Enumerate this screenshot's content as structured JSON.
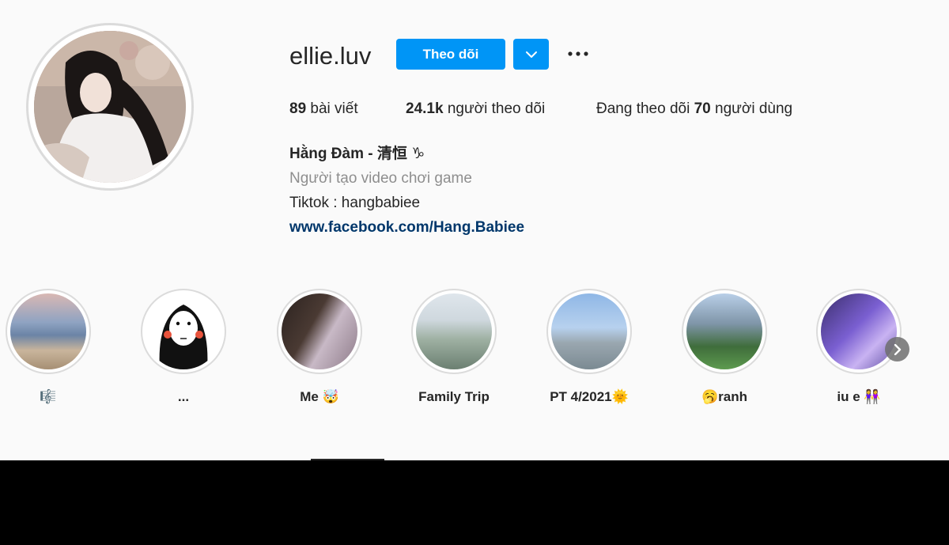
{
  "profile": {
    "username": "ellie.luv",
    "follow_label": "Theo dõi",
    "dropdown_icon": "chevron-down-icon",
    "more_icon": "more-options-icon"
  },
  "stats": {
    "posts_count": "89",
    "posts_label": " bài viết",
    "followers_count": "24.1k",
    "followers_label": " người theo dõi",
    "following_prefix": "Đang theo dõi ",
    "following_count": "70",
    "following_suffix": " người dùng"
  },
  "bio": {
    "name": "Hằng Đàm - 清恒 ♑",
    "category": "Người tạo video chơi game",
    "text": "Tiktok : hangbabiee",
    "link": "www.facebook.com/Hang.Babiee"
  },
  "highlights": [
    {
      "label": "🎼"
    },
    {
      "label": "..."
    },
    {
      "label": "Me 🤯"
    },
    {
      "label": "Family Trip"
    },
    {
      "label": "PT 4/2021🌞"
    },
    {
      "label": "🥱ranh"
    },
    {
      "label": "iu e 👭"
    }
  ],
  "colors": {
    "accent": "#0095f6",
    "link": "#00376b",
    "muted": "#8e8e8e",
    "text": "#262626",
    "background": "#fafafa"
  }
}
